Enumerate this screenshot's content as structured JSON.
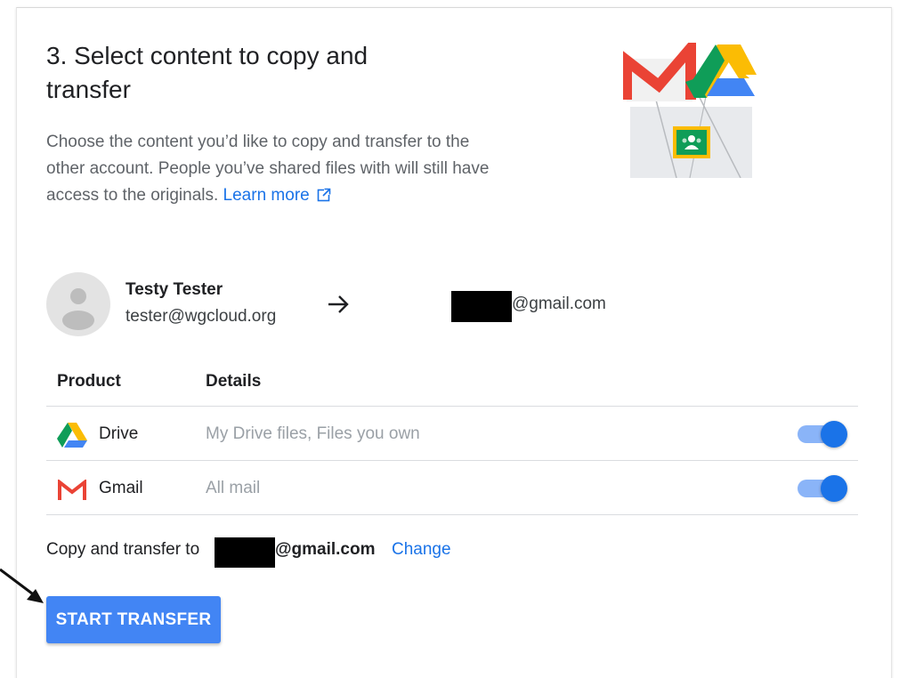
{
  "step": {
    "title": "3. Select content to copy and transfer",
    "description": "Choose the content you’d like to copy and transfer to the other account. People you’ve shared files with will still have access to the originals.",
    "learn_more_label": "Learn more"
  },
  "source_account": {
    "name": "Testy Tester",
    "email": "tester@wgcloud.org"
  },
  "destination_account": {
    "email_suffix": "@gmail.com"
  },
  "table": {
    "headers": [
      "Product",
      "Details"
    ],
    "rows": [
      {
        "product": "Drive",
        "details": "My Drive files, Files you own",
        "enabled": true,
        "icon": "google-drive-icon"
      },
      {
        "product": "Gmail",
        "details": "All mail",
        "enabled": true,
        "icon": "gmail-icon"
      }
    ]
  },
  "summary": {
    "prefix": "Copy and transfer to",
    "email_suffix": "@gmail.com",
    "change_label": "Change"
  },
  "actions": {
    "start_label": "START TRANSFER"
  },
  "colors": {
    "primary": "#1a73e8",
    "button": "#4285f4",
    "toggle_track": "#8ab4f8"
  }
}
